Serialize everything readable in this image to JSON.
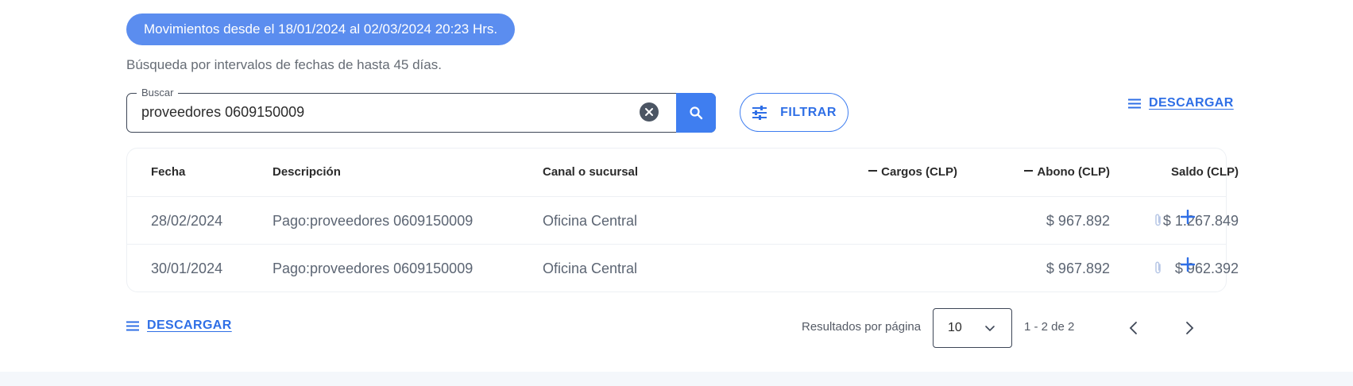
{
  "header": {
    "period_badge": "Movimientos desde el 18/01/2024 al 02/03/2024 20:23 Hrs.",
    "hint": "Búsqueda por intervalos de fechas de hasta 45 días."
  },
  "search": {
    "legend": "Buscar",
    "value": "proveedores 0609150009"
  },
  "toolbar": {
    "filter_label": "FILTRAR",
    "download_label": "DESCARGAR"
  },
  "table": {
    "columns": {
      "fecha": "Fecha",
      "descripcion": "Descripción",
      "canal": "Canal o sucursal",
      "cargos": "Cargos (CLP)",
      "abono": "Abono (CLP)",
      "saldo": "Saldo (CLP)"
    },
    "rows": [
      {
        "fecha": "28/02/2024",
        "descripcion": "Pago:proveedores 0609150009",
        "canal": "Oficina Central",
        "cargos": "",
        "abono": "$ 967.892",
        "saldo": "$ 1.267.849"
      },
      {
        "fecha": "30/01/2024",
        "descripcion": "Pago:proveedores 0609150009",
        "canal": "Oficina Central",
        "cargos": "",
        "abono": "$ 967.892",
        "saldo": "$ 962.392"
      }
    ]
  },
  "pagination": {
    "per_page_label": "Resultados por página",
    "per_page_value": "10",
    "range": "1 - 2 de 2"
  },
  "icons": {
    "search": "search-icon",
    "clear": "close-circle-icon",
    "filter": "sliders-icon",
    "download": "menu-lines-icon",
    "attachment": "paperclip-icon",
    "expand": "plus-icon",
    "select": "chevron-down-icon",
    "prev": "chevron-left-icon",
    "next": "chevron-right-icon"
  },
  "colors": {
    "accent": "#3f7ef0",
    "badge": "#5b8def",
    "link": "#2f6fe6"
  }
}
